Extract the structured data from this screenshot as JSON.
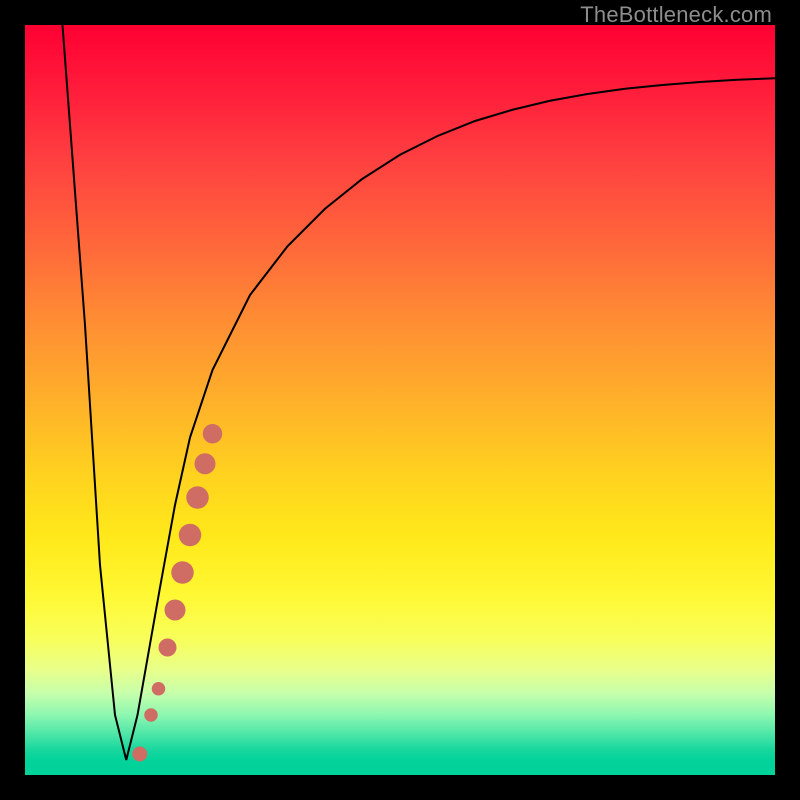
{
  "watermark": {
    "text": "TheBottleneck.com"
  },
  "colors": {
    "frame": "#000000",
    "curve": "#000000",
    "marker": "#cf6d64",
    "gradient_top": "#ff0033",
    "gradient_bottom": "#00d29a"
  },
  "chart_data": {
    "type": "line",
    "title": "",
    "xlabel": "",
    "ylabel": "",
    "xlim": [
      0,
      100
    ],
    "ylim": [
      0,
      100
    ],
    "grid": false,
    "note": "x,y in 0–100 plot-area units; y=0 is top, y=100 is bottom (higher y = lower on screen = greener/better).",
    "series": [
      {
        "name": "bottleneck-curve",
        "x": [
          5,
          8,
          10,
          12,
          13.5,
          15,
          18,
          20,
          22,
          25,
          30,
          35,
          40,
          45,
          50,
          55,
          60,
          65,
          70,
          75,
          80,
          85,
          90,
          95,
          100
        ],
        "y": [
          0,
          40,
          72,
          92,
          98,
          92,
          75,
          64,
          55,
          46,
          36,
          29.5,
          24.5,
          20.5,
          17.3,
          14.8,
          12.8,
          11.3,
          10.1,
          9.2,
          8.5,
          8.0,
          7.6,
          7.3,
          7.1
        ]
      }
    ],
    "markers": {
      "name": "highlighted-points",
      "color": "#cf6d64",
      "points": [
        {
          "x": 15.3,
          "y": 97.2,
          "r": 1.0
        },
        {
          "x": 16.8,
          "y": 92.0,
          "r": 0.9
        },
        {
          "x": 17.8,
          "y": 88.5,
          "r": 0.9
        },
        {
          "x": 19.0,
          "y": 83.0,
          "r": 1.2
        },
        {
          "x": 20.0,
          "y": 78.0,
          "r": 1.4
        },
        {
          "x": 21.0,
          "y": 73.0,
          "r": 1.5
        },
        {
          "x": 22.0,
          "y": 68.0,
          "r": 1.5
        },
        {
          "x": 23.0,
          "y": 63.0,
          "r": 1.5
        },
        {
          "x": 24.0,
          "y": 58.5,
          "r": 1.4
        },
        {
          "x": 25.0,
          "y": 54.5,
          "r": 1.3
        }
      ]
    }
  }
}
